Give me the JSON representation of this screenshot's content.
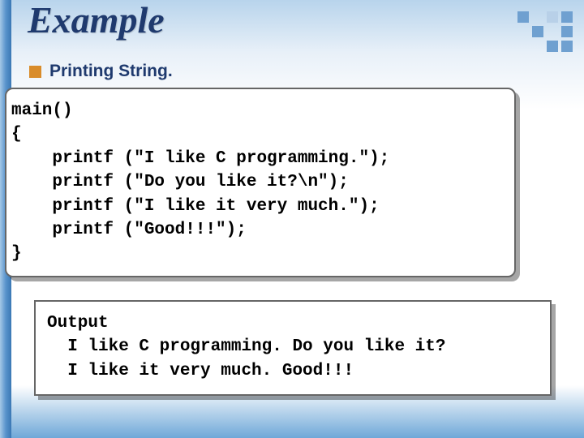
{
  "slide_title": "Example",
  "bullet": "Printing String.",
  "code_lines": "main()\n{\n    printf (\"I like C programming.\");\n    printf (\"Do you like it?\\n\");\n    printf (\"I like it very much.\");\n    printf (\"Good!!!\");\n}",
  "output_lines": "Output\n  I like C programming. Do you like it?\n  I like it very much. Good!!!",
  "colors": {
    "title": "#1f3a6e",
    "bullet_square": "#d98c2a",
    "accent": "#6fa0d0"
  }
}
